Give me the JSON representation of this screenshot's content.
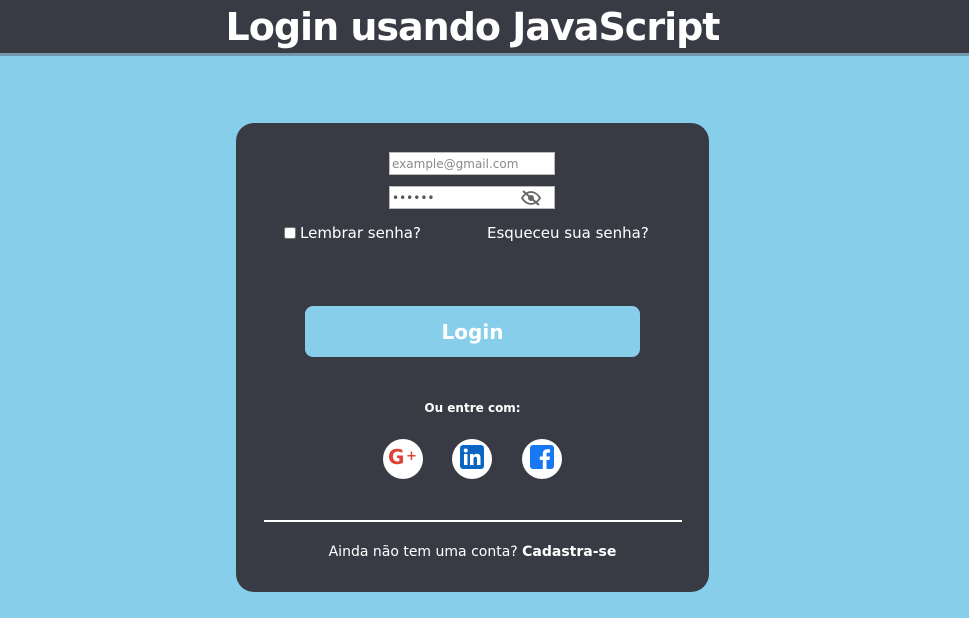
{
  "header": {
    "title": "Login usando JavaScript"
  },
  "form": {
    "email_placeholder": "example@gmail.com",
    "password_value": "******",
    "remember_label": "Lembrar senha?",
    "forgot_label": "Esqueceu sua senha?",
    "login_label": "Login",
    "or_label": "Ou entre com:",
    "signup_prompt": "Ainda não tem uma conta?",
    "signup_link": "Cadastra-se"
  },
  "social": [
    {
      "icon": "google-plus-icon",
      "color": "#db4437"
    },
    {
      "icon": "linkedin-icon",
      "color": "#0a66c2"
    },
    {
      "icon": "facebook-icon",
      "color": "#1877f2"
    }
  ],
  "colors": {
    "background": "#87ceeb",
    "card": "#393b44",
    "header": "#393b44",
    "button": "#87ceeb"
  }
}
